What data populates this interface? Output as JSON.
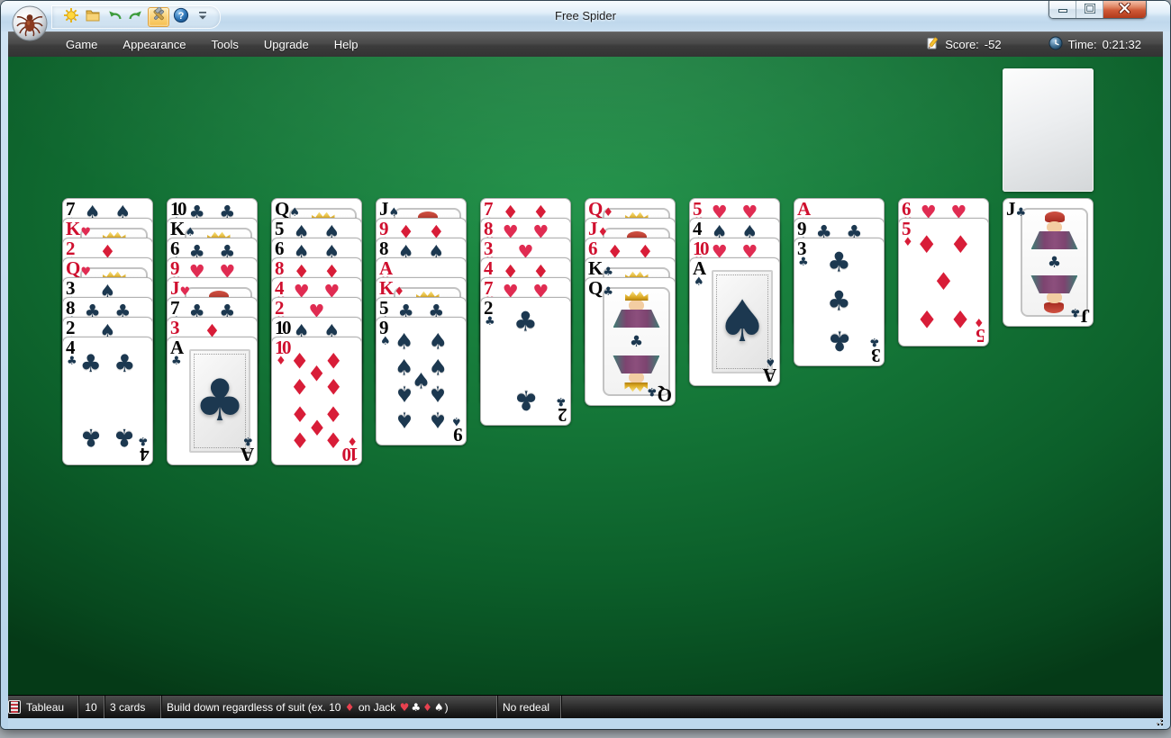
{
  "window": {
    "title": "Free Spider"
  },
  "titlebar": {
    "caption_buttons": [
      {
        "name": "minimize-button",
        "icon": "minimize-icon"
      },
      {
        "name": "maximize-button",
        "icon": "maximize-icon"
      },
      {
        "name": "close-button",
        "icon": "close-icon"
      }
    ],
    "quick_access": [
      {
        "name": "new-game-button",
        "icon": "sun-icon",
        "active": false
      },
      {
        "name": "open-button",
        "icon": "folder-icon",
        "active": false
      },
      {
        "name": "undo-button",
        "icon": "undo-arrow-icon",
        "active": false
      },
      {
        "name": "redo-button",
        "icon": "redo-arrow-icon",
        "active": false
      },
      {
        "name": "tools-button",
        "icon": "tools-icon",
        "active": true
      },
      {
        "name": "help-button",
        "icon": "help-icon",
        "active": false
      },
      {
        "name": "toolbar-overflow-button",
        "icon": "chevron-down-icon",
        "active": false
      }
    ]
  },
  "menubar": {
    "items": [
      "Game",
      "Appearance",
      "Tools",
      "Upgrade",
      "Help"
    ],
    "score_label": "Score:",
    "score_value": "-52",
    "time_label": "Time:",
    "time_value": "0:21:32"
  },
  "stock": {
    "empty": true
  },
  "tableau": {
    "columns": [
      [
        {
          "rank": "7",
          "suit": "spades"
        },
        {
          "rank": "K",
          "suit": "hearts"
        },
        {
          "rank": "2",
          "suit": "diamonds"
        },
        {
          "rank": "Q",
          "suit": "hearts"
        },
        {
          "rank": "3",
          "suit": "spades"
        },
        {
          "rank": "8",
          "suit": "clubs"
        },
        {
          "rank": "2",
          "suit": "spades"
        },
        {
          "rank": "4",
          "suit": "clubs"
        }
      ],
      [
        {
          "rank": "10",
          "suit": "clubs"
        },
        {
          "rank": "K",
          "suit": "spades"
        },
        {
          "rank": "6",
          "suit": "clubs"
        },
        {
          "rank": "9",
          "suit": "hearts"
        },
        {
          "rank": "J",
          "suit": "hearts"
        },
        {
          "rank": "7",
          "suit": "clubs"
        },
        {
          "rank": "3",
          "suit": "diamonds"
        },
        {
          "rank": "A",
          "suit": "clubs"
        }
      ],
      [
        {
          "rank": "Q",
          "suit": "spades"
        },
        {
          "rank": "5",
          "suit": "spades"
        },
        {
          "rank": "6",
          "suit": "spades"
        },
        {
          "rank": "8",
          "suit": "diamonds"
        },
        {
          "rank": "4",
          "suit": "hearts"
        },
        {
          "rank": "2",
          "suit": "hearts"
        },
        {
          "rank": "10",
          "suit": "spades"
        },
        {
          "rank": "10",
          "suit": "diamonds"
        }
      ],
      [
        {
          "rank": "J",
          "suit": "spades"
        },
        {
          "rank": "9",
          "suit": "diamonds"
        },
        {
          "rank": "8",
          "suit": "spades"
        },
        {
          "rank": "A",
          "suit": "hearts"
        },
        {
          "rank": "K",
          "suit": "diamonds"
        },
        {
          "rank": "5",
          "suit": "clubs"
        },
        {
          "rank": "9",
          "suit": "spades"
        }
      ],
      [
        {
          "rank": "7",
          "suit": "diamonds"
        },
        {
          "rank": "8",
          "suit": "hearts"
        },
        {
          "rank": "3",
          "suit": "hearts"
        },
        {
          "rank": "4",
          "suit": "diamonds"
        },
        {
          "rank": "7",
          "suit": "hearts"
        },
        {
          "rank": "2",
          "suit": "clubs"
        }
      ],
      [
        {
          "rank": "Q",
          "suit": "diamonds"
        },
        {
          "rank": "J",
          "suit": "diamonds"
        },
        {
          "rank": "6",
          "suit": "diamonds"
        },
        {
          "rank": "K",
          "suit": "clubs"
        },
        {
          "rank": "Q",
          "suit": "clubs"
        }
      ],
      [
        {
          "rank": "5",
          "suit": "hearts"
        },
        {
          "rank": "4",
          "suit": "spades"
        },
        {
          "rank": "10",
          "suit": "hearts"
        },
        {
          "rank": "A",
          "suit": "spades"
        }
      ],
      [
        {
          "rank": "A",
          "suit": "diamonds"
        },
        {
          "rank": "9",
          "suit": "clubs"
        },
        {
          "rank": "3",
          "suit": "clubs"
        }
      ],
      [
        {
          "rank": "6",
          "suit": "hearts"
        },
        {
          "rank": "5",
          "suit": "diamonds"
        }
      ],
      [
        {
          "rank": "J",
          "suit": "clubs"
        }
      ]
    ]
  },
  "statusbar": {
    "cell_type": "Tableau",
    "cell_count": "10",
    "deal_info": "3 cards",
    "rule_parts": [
      {
        "text": "Build down regardless of suit (ex. 10 "
      },
      {
        "suit": "diamonds"
      },
      {
        "text": " on Jack "
      },
      {
        "suit": "hearts"
      },
      {
        "suit": "clubs"
      },
      {
        "suit": "diamonds"
      },
      {
        "suit": "spades"
      },
      {
        "text": ")"
      }
    ],
    "redeal": "No redeal"
  },
  "colors": {
    "felt_green": "#147537",
    "suit_black": "#1c3850",
    "suit_hearts": "#e02c52",
    "suit_diamonds": "#d81d38",
    "rank_red": "#cf0f2e",
    "rank_black": "#060606",
    "status_suit_red": "#e8414f",
    "status_suit_white": "#ffffff"
  }
}
